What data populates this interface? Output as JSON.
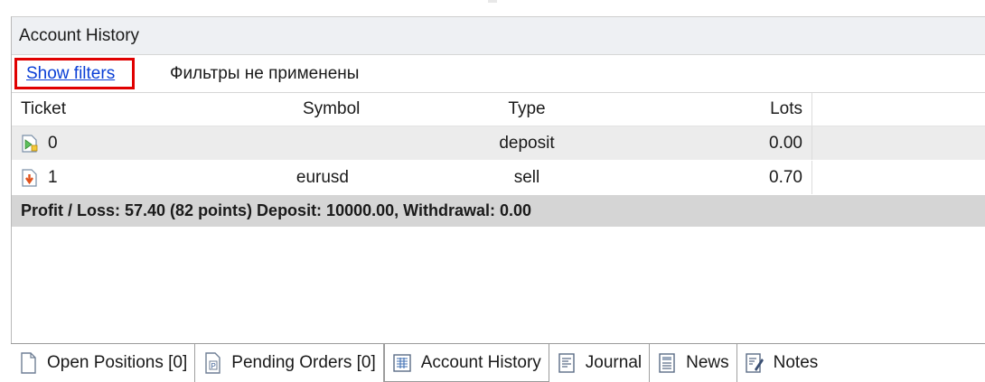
{
  "panel": {
    "title": "Account History"
  },
  "filters": {
    "link_label": "Show filters",
    "status": "Фильтры не применены"
  },
  "table": {
    "headers": {
      "ticket": "Ticket",
      "symbol": "Symbol",
      "type": "Type",
      "lots": "Lots"
    },
    "rows": [
      {
        "ticket": "0",
        "symbol": "",
        "type": "deposit",
        "lots": "0.00",
        "icon": "deposit-icon"
      },
      {
        "ticket": "1",
        "symbol": "eurusd",
        "type": "sell",
        "lots": "0.70",
        "icon": "sell-arrow-icon"
      }
    ],
    "summary": "Profit / Loss: 57.40 (82 points) Deposit: 10000.00, Withdrawal: 0.00"
  },
  "tabs": [
    {
      "label": "Open Positions [0]",
      "icon": "document-icon",
      "active": false
    },
    {
      "label": "Pending Orders [0]",
      "icon": "pending-document-icon",
      "active": false
    },
    {
      "label": "Account History",
      "icon": "history-grid-icon",
      "active": true
    },
    {
      "label": "Journal",
      "icon": "journal-icon",
      "active": false
    },
    {
      "label": "News",
      "icon": "news-icon",
      "active": false
    },
    {
      "label": "Notes",
      "icon": "notes-icon",
      "active": false
    }
  ],
  "colors": {
    "link": "#0a3fd6",
    "highlight_border": "#e00000",
    "summary_bg": "#d5d5d5",
    "alt_row": "#ececec"
  }
}
